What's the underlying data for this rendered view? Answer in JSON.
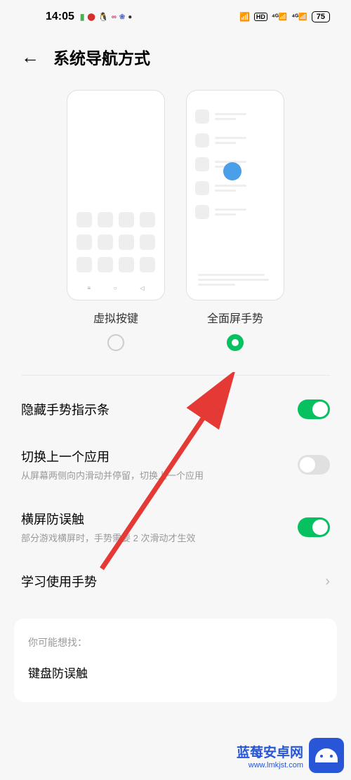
{
  "statusBar": {
    "time": "14:05",
    "battery": "75"
  },
  "header": {
    "title": "系统导航方式"
  },
  "navOptions": {
    "virtual": {
      "label": "虚拟按键",
      "selected": false
    },
    "gesture": {
      "label": "全面屏手势",
      "selected": true
    }
  },
  "settings": {
    "hideIndicator": {
      "title": "隐藏手势指示条",
      "enabled": true
    },
    "switchApp": {
      "title": "切换上一个应用",
      "subtitle": "从屏幕两侧向内滑动并停留，切换上一个应用",
      "enabled": false
    },
    "landscapeMistouch": {
      "title": "横屏防误触",
      "subtitle": "部分游戏横屏时，手势需要 2 次滑动才生效",
      "enabled": true
    },
    "learn": {
      "title": "学习使用手势"
    }
  },
  "suggestion": {
    "label": "你可能想找：",
    "item": "键盘防误触"
  },
  "watermark": {
    "title": "蓝莓安卓网",
    "url": "www.lmkjst.com"
  }
}
